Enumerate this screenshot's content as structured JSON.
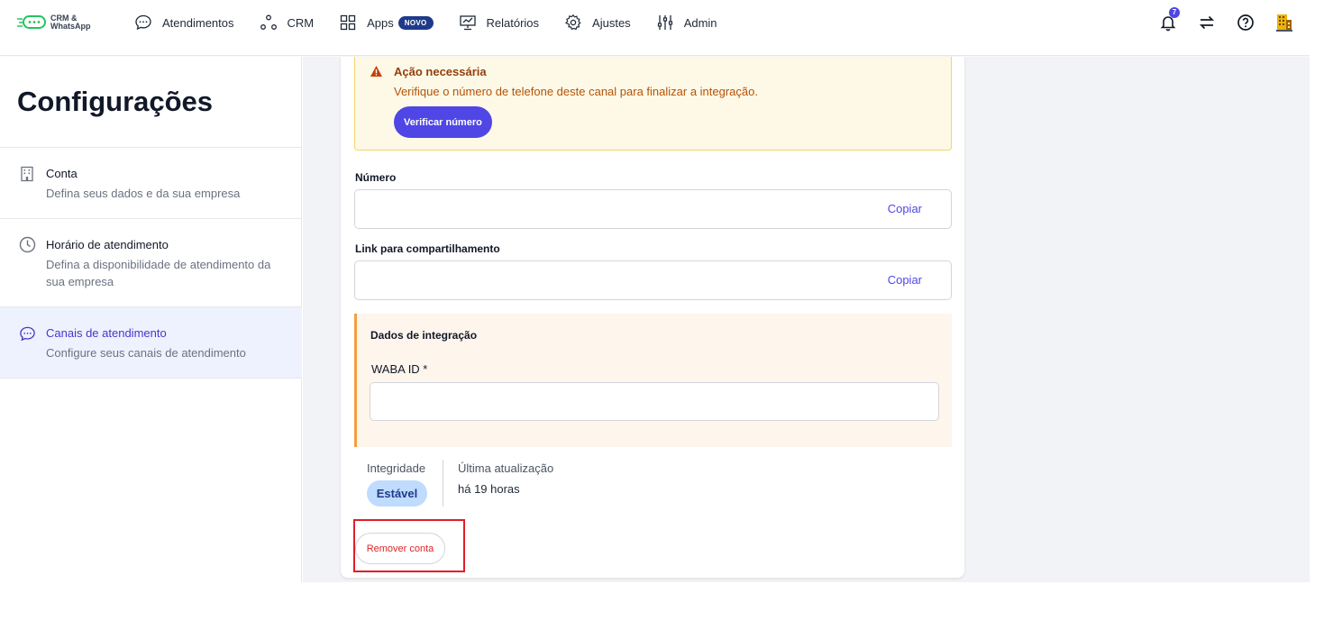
{
  "brand": {
    "line1": "CRM &",
    "line2": "WhatsApp",
    "icon": "chat-dots-logo"
  },
  "nav": {
    "items": [
      {
        "label": "Atendimentos",
        "icon": "chat-bubble-icon"
      },
      {
        "label": "CRM",
        "icon": "nodes-icon"
      },
      {
        "label": "Apps",
        "icon": "grid-icon",
        "badge": "NOVO"
      },
      {
        "label": "Relatórios",
        "icon": "presentation-chart-icon"
      },
      {
        "label": "Ajustes",
        "icon": "gear-icon"
      },
      {
        "label": "Admin",
        "icon": "sliders-icon"
      }
    ],
    "notification_count": "7"
  },
  "sidebar": {
    "title": "Configurações",
    "items": [
      {
        "title": "Conta",
        "desc": "Defina seus dados e da sua empresa",
        "icon": "building-icon"
      },
      {
        "title": "Horário de atendimento",
        "desc": "Defina a disponibilidade de atendimento da sua empresa",
        "icon": "clock-icon"
      },
      {
        "title": "Canais de atendimento",
        "desc": "Configure seus canais de atendimento",
        "icon": "chat-bubble-icon",
        "active": true
      }
    ]
  },
  "alert": {
    "title": "Ação necessária",
    "text": "Verifique o número de telefone deste canal para finalizar a integração.",
    "button": "Verificar número"
  },
  "fields": {
    "numero_label": "Número",
    "numero_copy": "Copiar",
    "link_label": "Link para compartilhamento",
    "link_copy": "Copiar"
  },
  "integration": {
    "title": "Dados de integração",
    "waba_label": "WABA ID *",
    "waba_value": ""
  },
  "status": {
    "integrity_label": "Integridade",
    "integrity_value": "Estável",
    "update_label": "Última atualização",
    "update_value": "há 19 horas"
  },
  "remove_button": "Remover conta",
  "colors": {
    "accent": "#4f46e5",
    "danger": "#dc2626",
    "warning": "#f59e42"
  }
}
